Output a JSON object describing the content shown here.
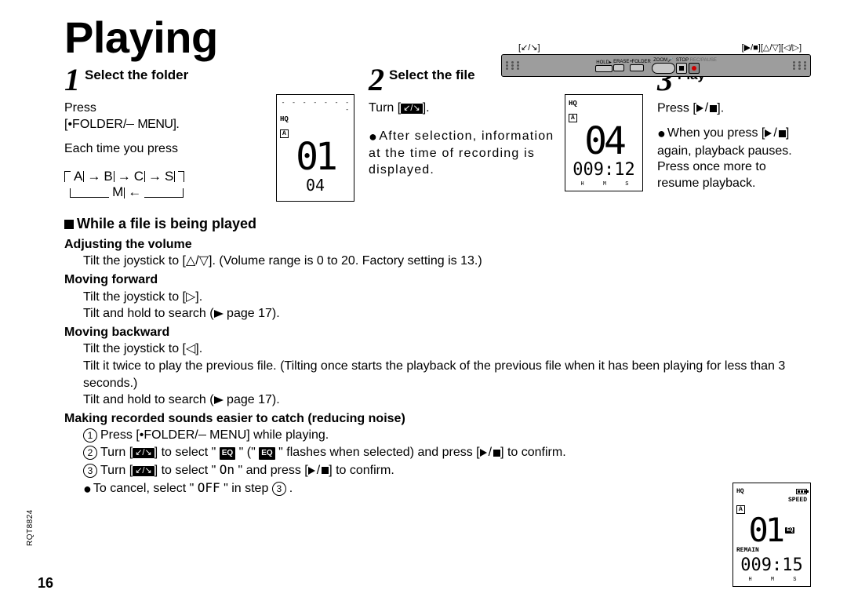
{
  "title": "Playing",
  "device": {
    "label_left": "[↙/↘]",
    "label_right": "[▶/■][△/▽][◁/▷]",
    "keys": {
      "hold": "HOLD▸",
      "erase": "ERASE",
      "folder": "•FOLDER",
      "zoom": "ZOOM🎤",
      "stop": "STOP",
      "rec": "REC/PAUSE"
    }
  },
  "step1": {
    "num": "1",
    "title": "Select the folder",
    "line1": "Press",
    "line2_a": "[•FOLDER/",
    "line2_b": " MENU].",
    "line3": "Each time you press",
    "cycle": {
      "A": "A",
      "B": "B",
      "C": "C",
      "S": "S",
      "M": "M"
    },
    "lcd": {
      "hq": "HQ",
      "folder": "A",
      "big": "01",
      "small": "04"
    }
  },
  "step2": {
    "num": "2",
    "title": "Select the file",
    "line1_a": "Turn [",
    "line1_b": "].",
    "note": "After  selection, information at the time of recording is displayed.",
    "lcd": {
      "hq": "HQ",
      "folder": "A",
      "big": "04",
      "time": "009:12",
      "hms": "H   M   S"
    }
  },
  "step3": {
    "num": "3",
    "title": "Play",
    "line1_a": "Press [",
    "line1_b": "].",
    "note_a": "When you press [",
    "note_b": "] again, playback pauses. Press once more to resume playback."
  },
  "section2": {
    "heading": "While a file is being played",
    "vol_h": "Adjusting the volume",
    "vol_t": "Tilt the joystick to [△/▽]. (Volume range is 0 to 20. Factory setting is 13.)",
    "fwd_h": "Moving forward",
    "fwd_t1": "Tilt the joystick to [▷].",
    "fwd_t2_a": "Tilt and hold to search (",
    "fwd_t2_b": " page 17).",
    "bwd_h": "Moving backward",
    "bwd_t1": "Tilt the joystick to [◁].",
    "bwd_t2": "Tilt it twice to play the previous file. (Tilting once starts the playback of the previous file when it has been playing for less than 3 seconds.)",
    "bwd_t3_a": "Tilt and hold to search (",
    "bwd_t3_b": " page 17).",
    "eq_h": "Making recorded sounds easier to catch (reducing noise)",
    "eq_1_a": "Press [•FOLDER/",
    "eq_1_b": " MENU] while playing.",
    "eq_2_a": "Turn [",
    "eq_2_b": "] to select \" ",
    "eq_2_c": " \" (\" ",
    "eq_2_d": " \" flashes when selected) and press [",
    "eq_2_e": "] to confirm.",
    "eq_3_a": "Turn [",
    "eq_3_b": "] to select \" ",
    "eq_3_on": "On",
    "eq_3_c": " \" and press [",
    "eq_3_d": "] to confirm.",
    "cancel_a": "To cancel, select \" ",
    "cancel_off": "OFF",
    "cancel_b": " \" in step ",
    "cancel_step": "3",
    "eq_label": "EQ"
  },
  "lcd_bottom": {
    "hq": "HQ",
    "speed": "SPEED",
    "folder": "A",
    "big": "01",
    "eq": "EQ",
    "remain": "REMAIN",
    "time": "009:15",
    "hms": "H   M   S"
  },
  "page_number": "16",
  "doc_id": "RQT8824"
}
